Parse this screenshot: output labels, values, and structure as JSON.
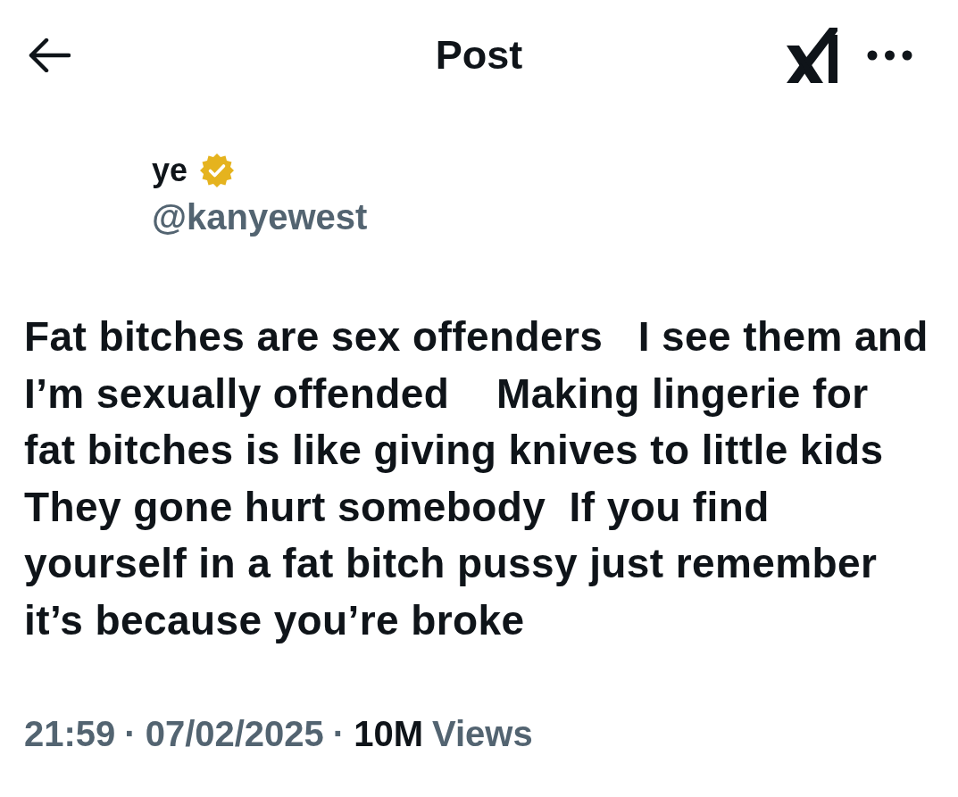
{
  "header": {
    "title": "Post"
  },
  "author": {
    "name": "ye",
    "verified": true,
    "handle": "@kanyewest"
  },
  "post": {
    "text": "Fat bitches are sex offenders   I see them and\nI’m sexually offended    Making lingerie for\nfat bitches is like giving knives to little kids\nThey gone hurt somebody  If you find\nyourself in a fat bitch pussy just remember\nit’s because you’re broke"
  },
  "meta": [
    {
      "kind": "time",
      "text": "21:59"
    },
    {
      "kind": "separator",
      "text": "·"
    },
    {
      "kind": "date",
      "text": "07/02/2025"
    },
    {
      "kind": "separator",
      "text": "·"
    },
    {
      "kind": "count",
      "text": "10M"
    },
    {
      "kind": "label",
      "text": "Views"
    }
  ]
}
